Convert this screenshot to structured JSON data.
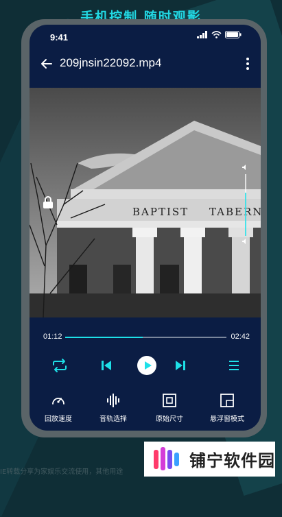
{
  "banner": "手机控制 随时观影",
  "status_bar": {
    "time": "9:41"
  },
  "app_bar": {
    "title": "209jnsin22092.mp4"
  },
  "video": {
    "sign_left": "BAPTIST",
    "sign_right": "TABERNA"
  },
  "volume": {
    "level": 0.7
  },
  "progress": {
    "current": "01:12",
    "duration": "02:42",
    "fraction": 0.48
  },
  "features": [
    {
      "label": "回放速度",
      "icon": "speedometer-icon"
    },
    {
      "label": "音轨选择",
      "icon": "audio-wave-icon"
    },
    {
      "label": "原始尺寸",
      "icon": "original-size-icon"
    },
    {
      "label": "悬浮窗模式",
      "icon": "float-window-icon"
    }
  ],
  "watermark": {
    "brand": "铺宁软件园",
    "caption": "IE转载分享为家娱乐交流使用，其他用途"
  },
  "colors": {
    "accent": "#1ee0e8",
    "screen_bg": "#0b1d44",
    "frame": "#5a6468"
  }
}
